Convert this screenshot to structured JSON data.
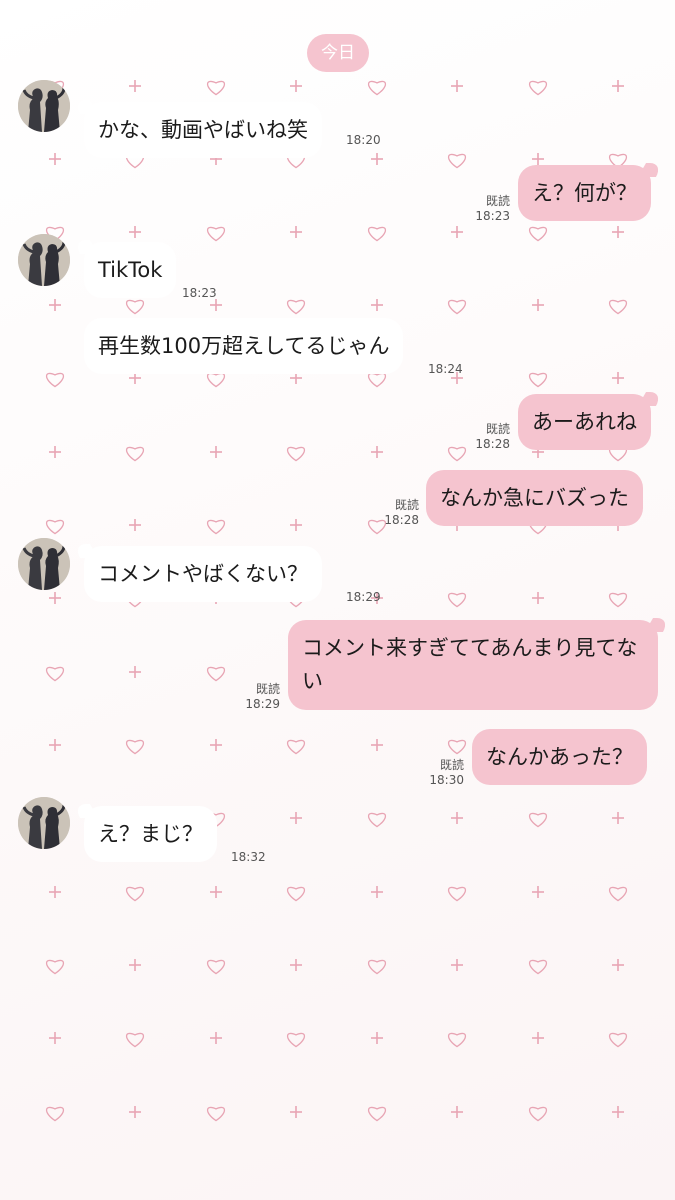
{
  "chat": {
    "date_label": "今日",
    "messages": [
      {
        "side": "in",
        "text": "かな、動画やばいね笑",
        "time": "18:20"
      },
      {
        "side": "out",
        "text": "え？何が？",
        "read": "既読",
        "time": "18:23"
      },
      {
        "side": "in",
        "text": "TikTok",
        "time": "18:23"
      },
      {
        "side": "in",
        "text": "再生数100万超えしてるじゃん",
        "time": "18:24"
      },
      {
        "side": "out",
        "text": "あーあれね",
        "read": "既読",
        "time": "18:28"
      },
      {
        "side": "out",
        "text": "なんか急にバズった",
        "read": "既読",
        "time": "18:28"
      },
      {
        "side": "in",
        "text": "コメントやばくない？",
        "time": "18:29"
      },
      {
        "side": "out",
        "text": "コメント来すぎててあんまり見てない",
        "read": "既読",
        "time": "18:29"
      },
      {
        "side": "out",
        "text": "なんかあった？",
        "read": "既読",
        "time": "18:30"
      },
      {
        "side": "in",
        "text": "え？まじ？",
        "time": "18:32"
      }
    ]
  },
  "theme": {
    "bubble_out": "#f5c4cf",
    "bubble_in": "#ffffff",
    "pattern_color": "#e8a5b4",
    "pattern_icons": [
      "heart-outline-icon",
      "plus-icon"
    ]
  }
}
